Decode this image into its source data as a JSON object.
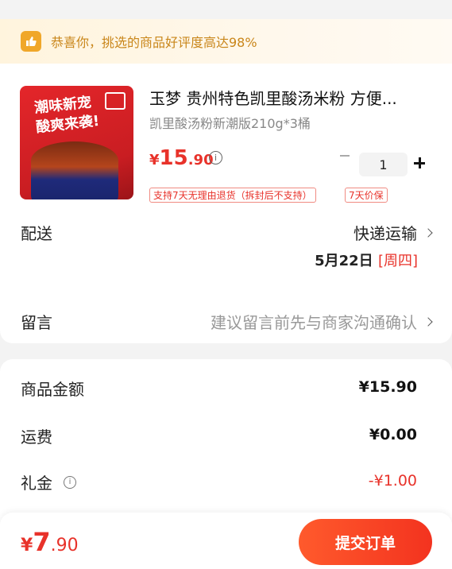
{
  "banner": {
    "text": "恭喜你，挑选的商品好评度高达98%"
  },
  "product": {
    "title": "玉梦 贵州特色凯里酸汤米粉 方便...",
    "subtitle": "凯里酸汤粉新潮版210g*3桶",
    "image_text_line1": "潮味新宠",
    "image_text_line2": "酸爽来袭!",
    "price_symbol": "¥",
    "price_int": "15",
    "price_dec": ".90",
    "quantity": "1",
    "tags": [
      "支持7天无理由退货（拆封后不支持）",
      "7天价保"
    ]
  },
  "delivery": {
    "label": "配送",
    "method": "快递运输",
    "date": "5月22日",
    "weekday": "[周四]"
  },
  "message": {
    "label": "留言",
    "placeholder": "建议留言前先与商家沟通确认"
  },
  "summary": {
    "goods_label": "商品金额",
    "goods_value": "¥15.90",
    "shipping_label": "运费",
    "shipping_value": "¥0.00",
    "gift_label": "礼金",
    "gift_value": "-¥1.00"
  },
  "footer": {
    "total_symbol": "¥",
    "total_int": "7",
    "total_dec": ".90",
    "submit_label": "提交订单"
  },
  "colors": {
    "accent": "#e8322a",
    "banner_text": "#c9861a",
    "submit_start": "#ff5a2c",
    "submit_end": "#f3331f"
  }
}
